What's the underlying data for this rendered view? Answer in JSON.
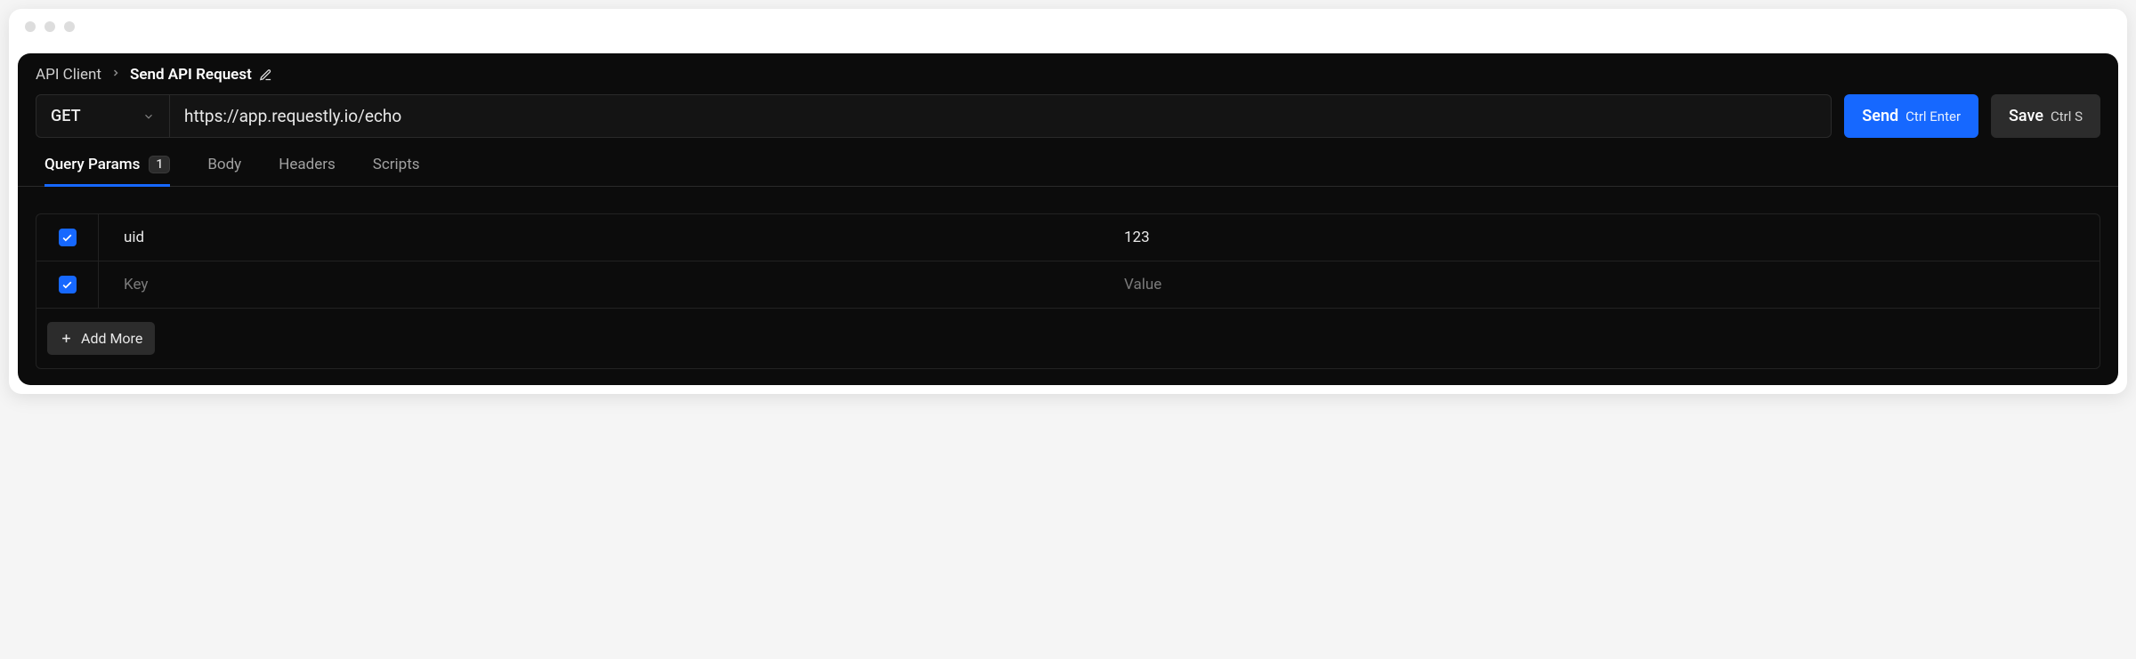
{
  "breadcrumb": {
    "root": "API Client",
    "current": "Send API Request"
  },
  "request": {
    "method": "GET",
    "url": "https://app.requestly.io/echo"
  },
  "actions": {
    "send_label": "Send",
    "send_shortcut": "Ctrl Enter",
    "save_label": "Save",
    "save_shortcut": "Ctrl S"
  },
  "tabs": {
    "query_params": {
      "label": "Query Params",
      "count": "1",
      "active": true
    },
    "body": {
      "label": "Body"
    },
    "headers": {
      "label": "Headers"
    },
    "scripts": {
      "label": "Scripts"
    }
  },
  "params": {
    "rows": [
      {
        "enabled": true,
        "key": "uid",
        "value": "123"
      },
      {
        "enabled": true,
        "key": "",
        "value": ""
      }
    ],
    "key_placeholder": "Key",
    "value_placeholder": "Value",
    "add_more_label": "Add More"
  }
}
